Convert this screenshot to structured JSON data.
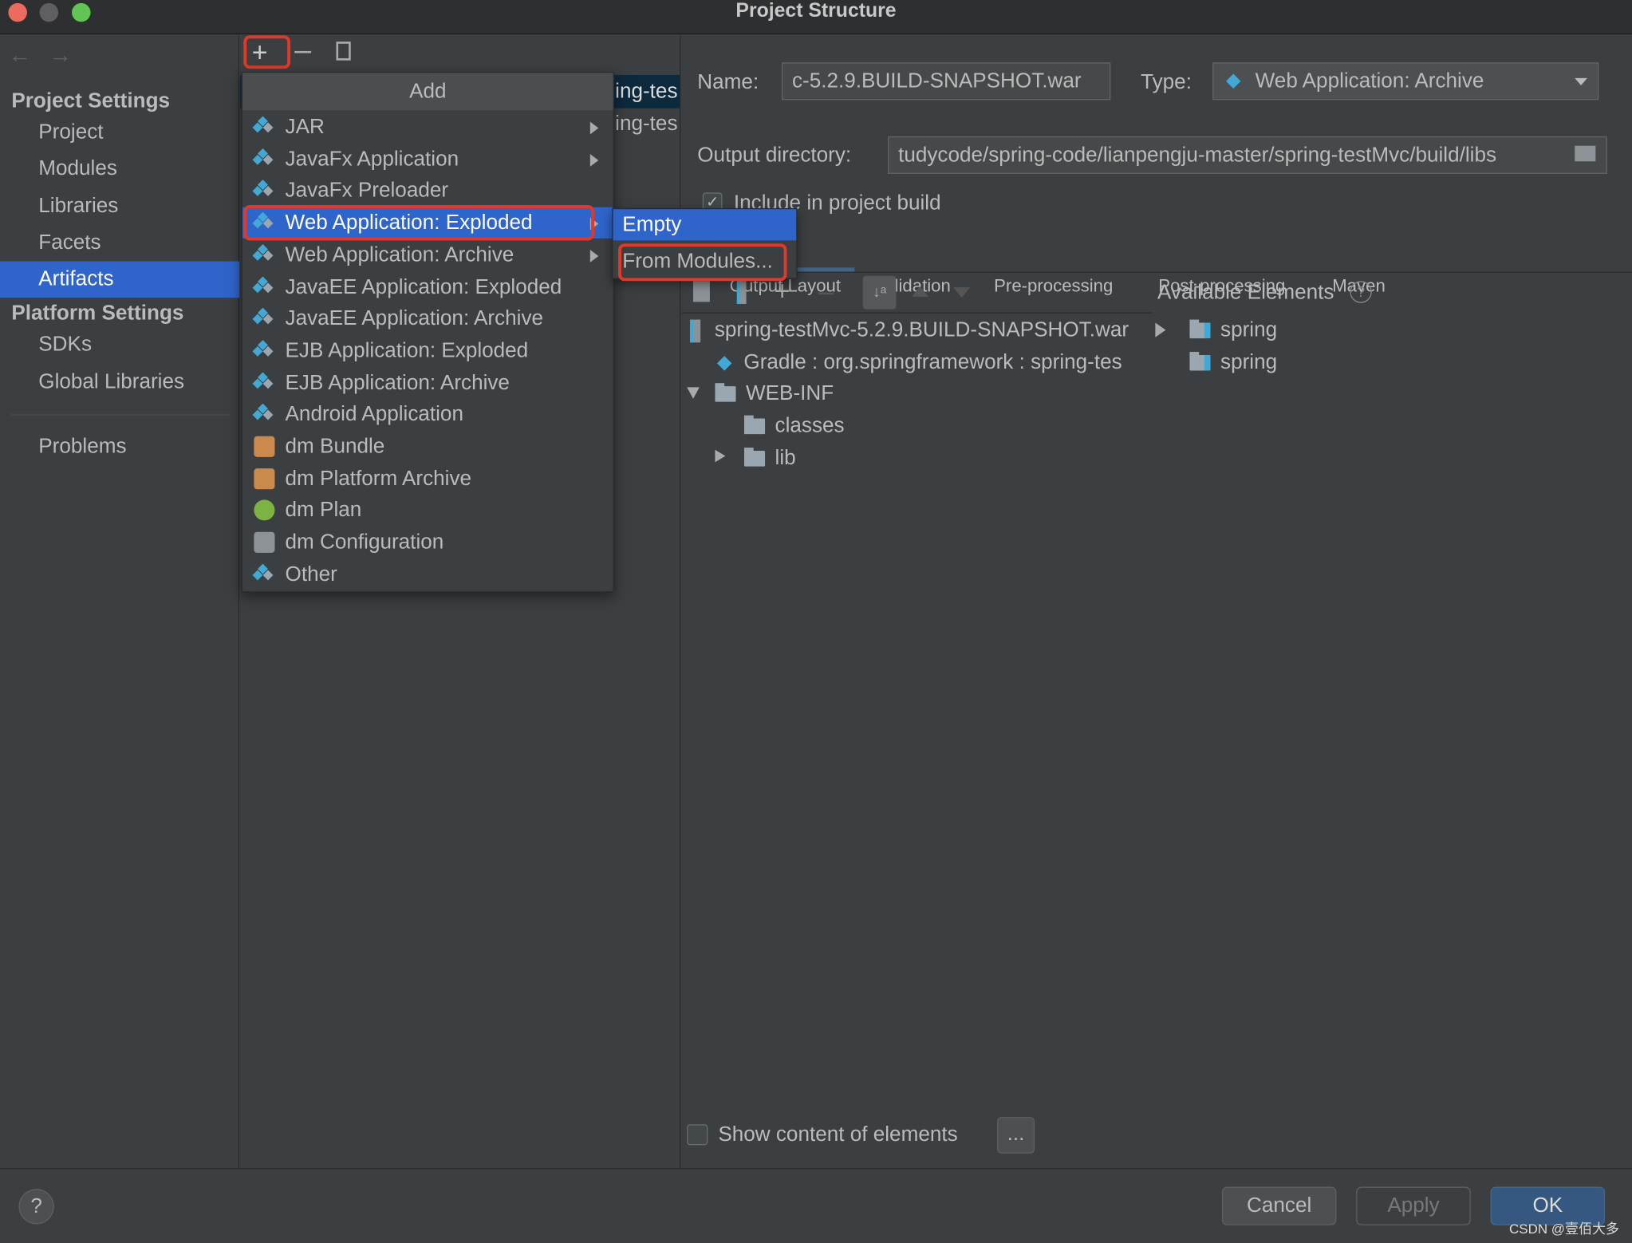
{
  "window": {
    "title": "Project Structure"
  },
  "sidebar": {
    "project_settings_header": "Project Settings",
    "project_items": [
      "Project",
      "Modules",
      "Libraries",
      "Facets",
      "Artifacts"
    ],
    "selected": "Artifacts",
    "platform_settings_header": "Platform Settings",
    "platform_items": [
      "SDKs",
      "Global Libraries"
    ],
    "problems": "Problems"
  },
  "artifact_list": {
    "items": [
      "ing-tes",
      "ing-tes"
    ]
  },
  "add_menu": {
    "header": "Add",
    "items": [
      {
        "label": "JAR",
        "icon": "artifact-icon",
        "submenu": true
      },
      {
        "label": "JavaFx Application",
        "icon": "artifact-icon",
        "submenu": true
      },
      {
        "label": "JavaFx Preloader",
        "icon": "artifact-icon",
        "submenu": false
      },
      {
        "label": "Web Application: Exploded",
        "icon": "web-artifact-icon",
        "submenu": true,
        "selected": true
      },
      {
        "label": "Web Application: Archive",
        "icon": "web-artifact-icon",
        "submenu": true
      },
      {
        "label": "JavaEE Application: Exploded",
        "icon": "javaee-artifact-icon",
        "submenu": false
      },
      {
        "label": "JavaEE Application: Archive",
        "icon": "javaee-artifact-icon",
        "submenu": false
      },
      {
        "label": "EJB Application: Exploded",
        "icon": "ejb-artifact-icon",
        "submenu": false
      },
      {
        "label": "EJB Application: Archive",
        "icon": "ejb-artifact-icon",
        "submenu": false
      },
      {
        "label": "Android Application",
        "icon": "artifact-icon",
        "submenu": false
      },
      {
        "label": "dm Bundle",
        "icon": "dm-bundle-icon",
        "submenu": false
      },
      {
        "label": "dm Platform Archive",
        "icon": "dm-platform-icon",
        "submenu": false
      },
      {
        "label": "dm Plan",
        "icon": "dm-plan-icon",
        "submenu": false
      },
      {
        "label": "dm Configuration",
        "icon": "dm-config-icon",
        "submenu": false
      },
      {
        "label": "Other",
        "icon": "artifact-icon",
        "submenu": false
      }
    ]
  },
  "submenu": {
    "items": [
      "Empty",
      "From Modules..."
    ],
    "selected": "Empty"
  },
  "details": {
    "name_label": "Name:",
    "name_value": "c-5.2.9.BUILD-SNAPSHOT.war",
    "type_label": "Type:",
    "type_value": "Web Application: Archive",
    "output_label": "Output directory:",
    "output_value": "tudycode/spring-code/lianpengju-master/spring-testMvc/build/libs",
    "include_label": "Include in project build",
    "include_checked": true,
    "tabs": [
      "Output Layout",
      "Validation",
      "Pre-processing",
      "Post-processing",
      "Maven"
    ],
    "active_tab": "Output Layout",
    "available_elements": "Available Elements",
    "tree": [
      "spring-testMvc-5.2.9.BUILD-SNAPSHOT.war",
      "Gradle : org.springframework : spring-tes",
      "WEB-INF",
      "classes",
      "lib"
    ],
    "available": [
      "spring",
      "spring"
    ],
    "show_content_label": "Show content of elements",
    "show_content_checked": false,
    "more_button": "..."
  },
  "footer": {
    "help": "?",
    "cancel": "Cancel",
    "apply": "Apply",
    "ok": "OK"
  },
  "watermark": "CSDN @壹佰大多",
  "colors": {
    "selection": "#2f65ca",
    "highlight_box": "#e0392a",
    "ok_button": "#365880",
    "background": "#3c3f41"
  }
}
